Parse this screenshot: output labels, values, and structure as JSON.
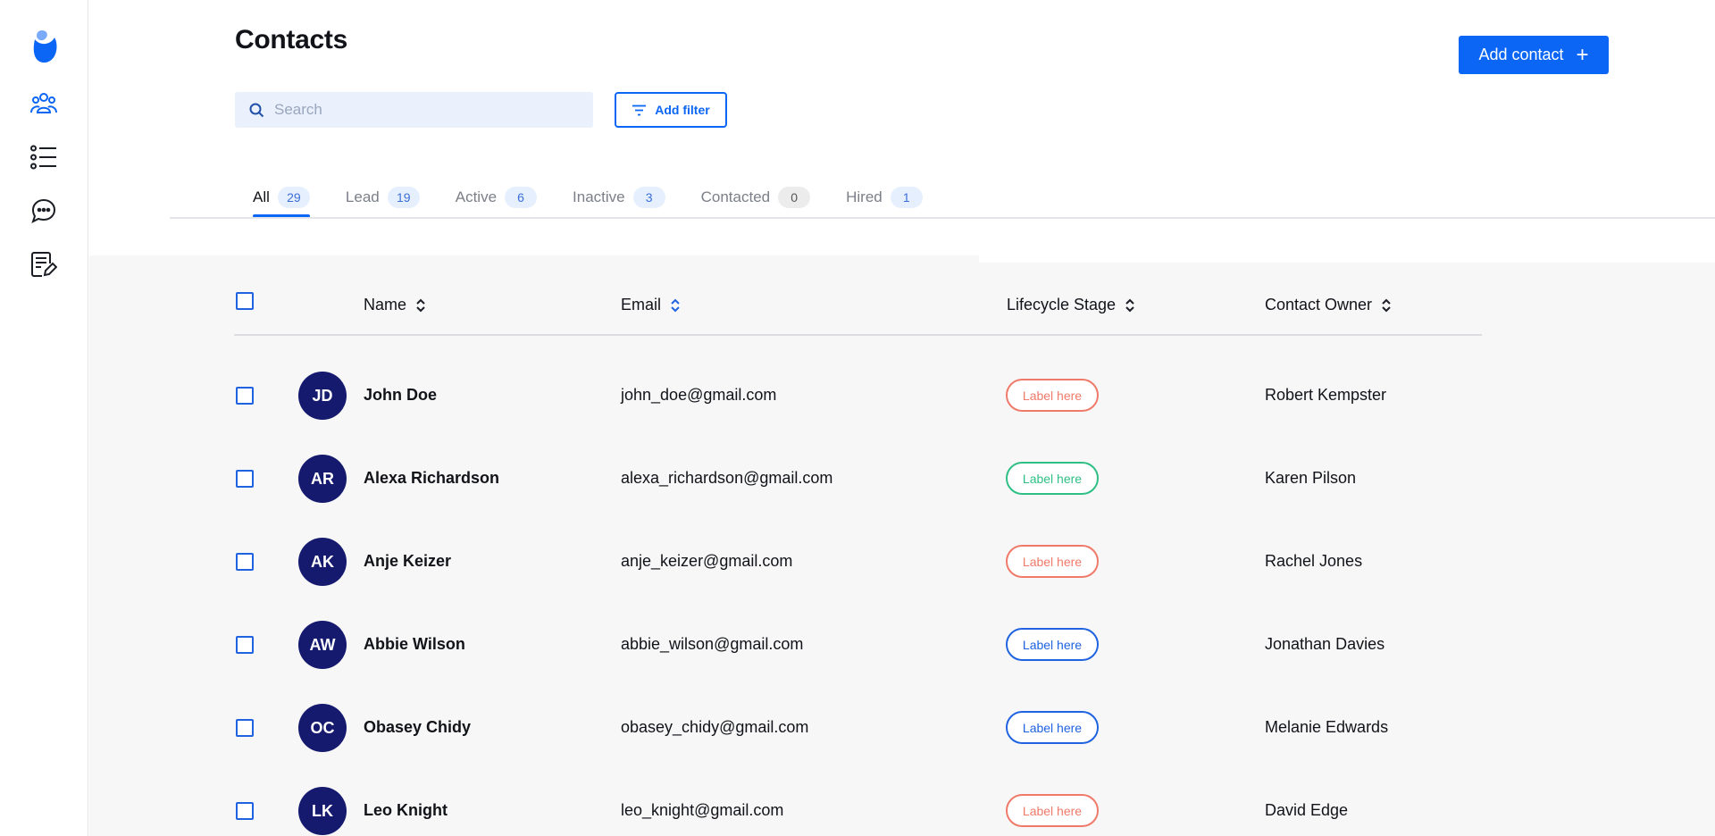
{
  "sidebar": {
    "items": [
      {
        "name": "contacts",
        "icon": "people-group-icon"
      },
      {
        "name": "list",
        "icon": "list-icon"
      },
      {
        "name": "messages",
        "icon": "chat-bubble-icon"
      },
      {
        "name": "notes",
        "icon": "notes-edit-icon"
      }
    ],
    "accent": "#0b66f5"
  },
  "header": {
    "title": "Contacts",
    "add_contact_label": "Add contact",
    "add_contact_icon": "+",
    "search_placeholder": "Search",
    "search_value": "",
    "add_filter_label": "Add filter"
  },
  "tabs": [
    {
      "label": "All",
      "count": "29",
      "active": true
    },
    {
      "label": "Lead",
      "count": "19",
      "active": false
    },
    {
      "label": "Active",
      "count": "6",
      "active": false
    },
    {
      "label": "Inactive",
      "count": "3",
      "active": false
    },
    {
      "label": "Contacted",
      "count": "0",
      "active": false
    },
    {
      "label": "Hired",
      "count": "1",
      "active": false
    }
  ],
  "table": {
    "columns": {
      "name": "Name",
      "email": "Email",
      "stage": "Lifecycle Stage",
      "owner": "Contact Owner"
    },
    "rows": [
      {
        "initials": "JD",
        "name": "John Doe",
        "email": "john_doe@gmail.com",
        "stage": "Label here",
        "stage_color": "#f07a6a",
        "owner": "Robert Kempster"
      },
      {
        "initials": "AR",
        "name": "Alexa Richardson",
        "email": "alexa_richardson@gmail.com",
        "stage": "Label here",
        "stage_color": "#2fbf84",
        "owner": "Karen Pilson"
      },
      {
        "initials": "AK",
        "name": "Anje Keizer",
        "email": "anje_keizer@gmail.com",
        "stage": "Label here",
        "stage_color": "#f07a6a",
        "owner": "Rachel Jones"
      },
      {
        "initials": "AW",
        "name": "Abbie Wilson",
        "email": "abbie_wilson@gmail.com",
        "stage": "Label here",
        "stage_color": "#1f63e0",
        "owner": "Jonathan Davies"
      },
      {
        "initials": "OC",
        "name": "Obasey Chidy",
        "email": "obasey_chidy@gmail.com",
        "stage": "Label here",
        "stage_color": "#1f63e0",
        "owner": "Melanie Edwards"
      },
      {
        "initials": "LK",
        "name": "Leo Knight",
        "email": "leo_knight@gmail.com",
        "stage": "Label here",
        "stage_color": "#f07a6a",
        "owner": "David Edge"
      }
    ]
  }
}
